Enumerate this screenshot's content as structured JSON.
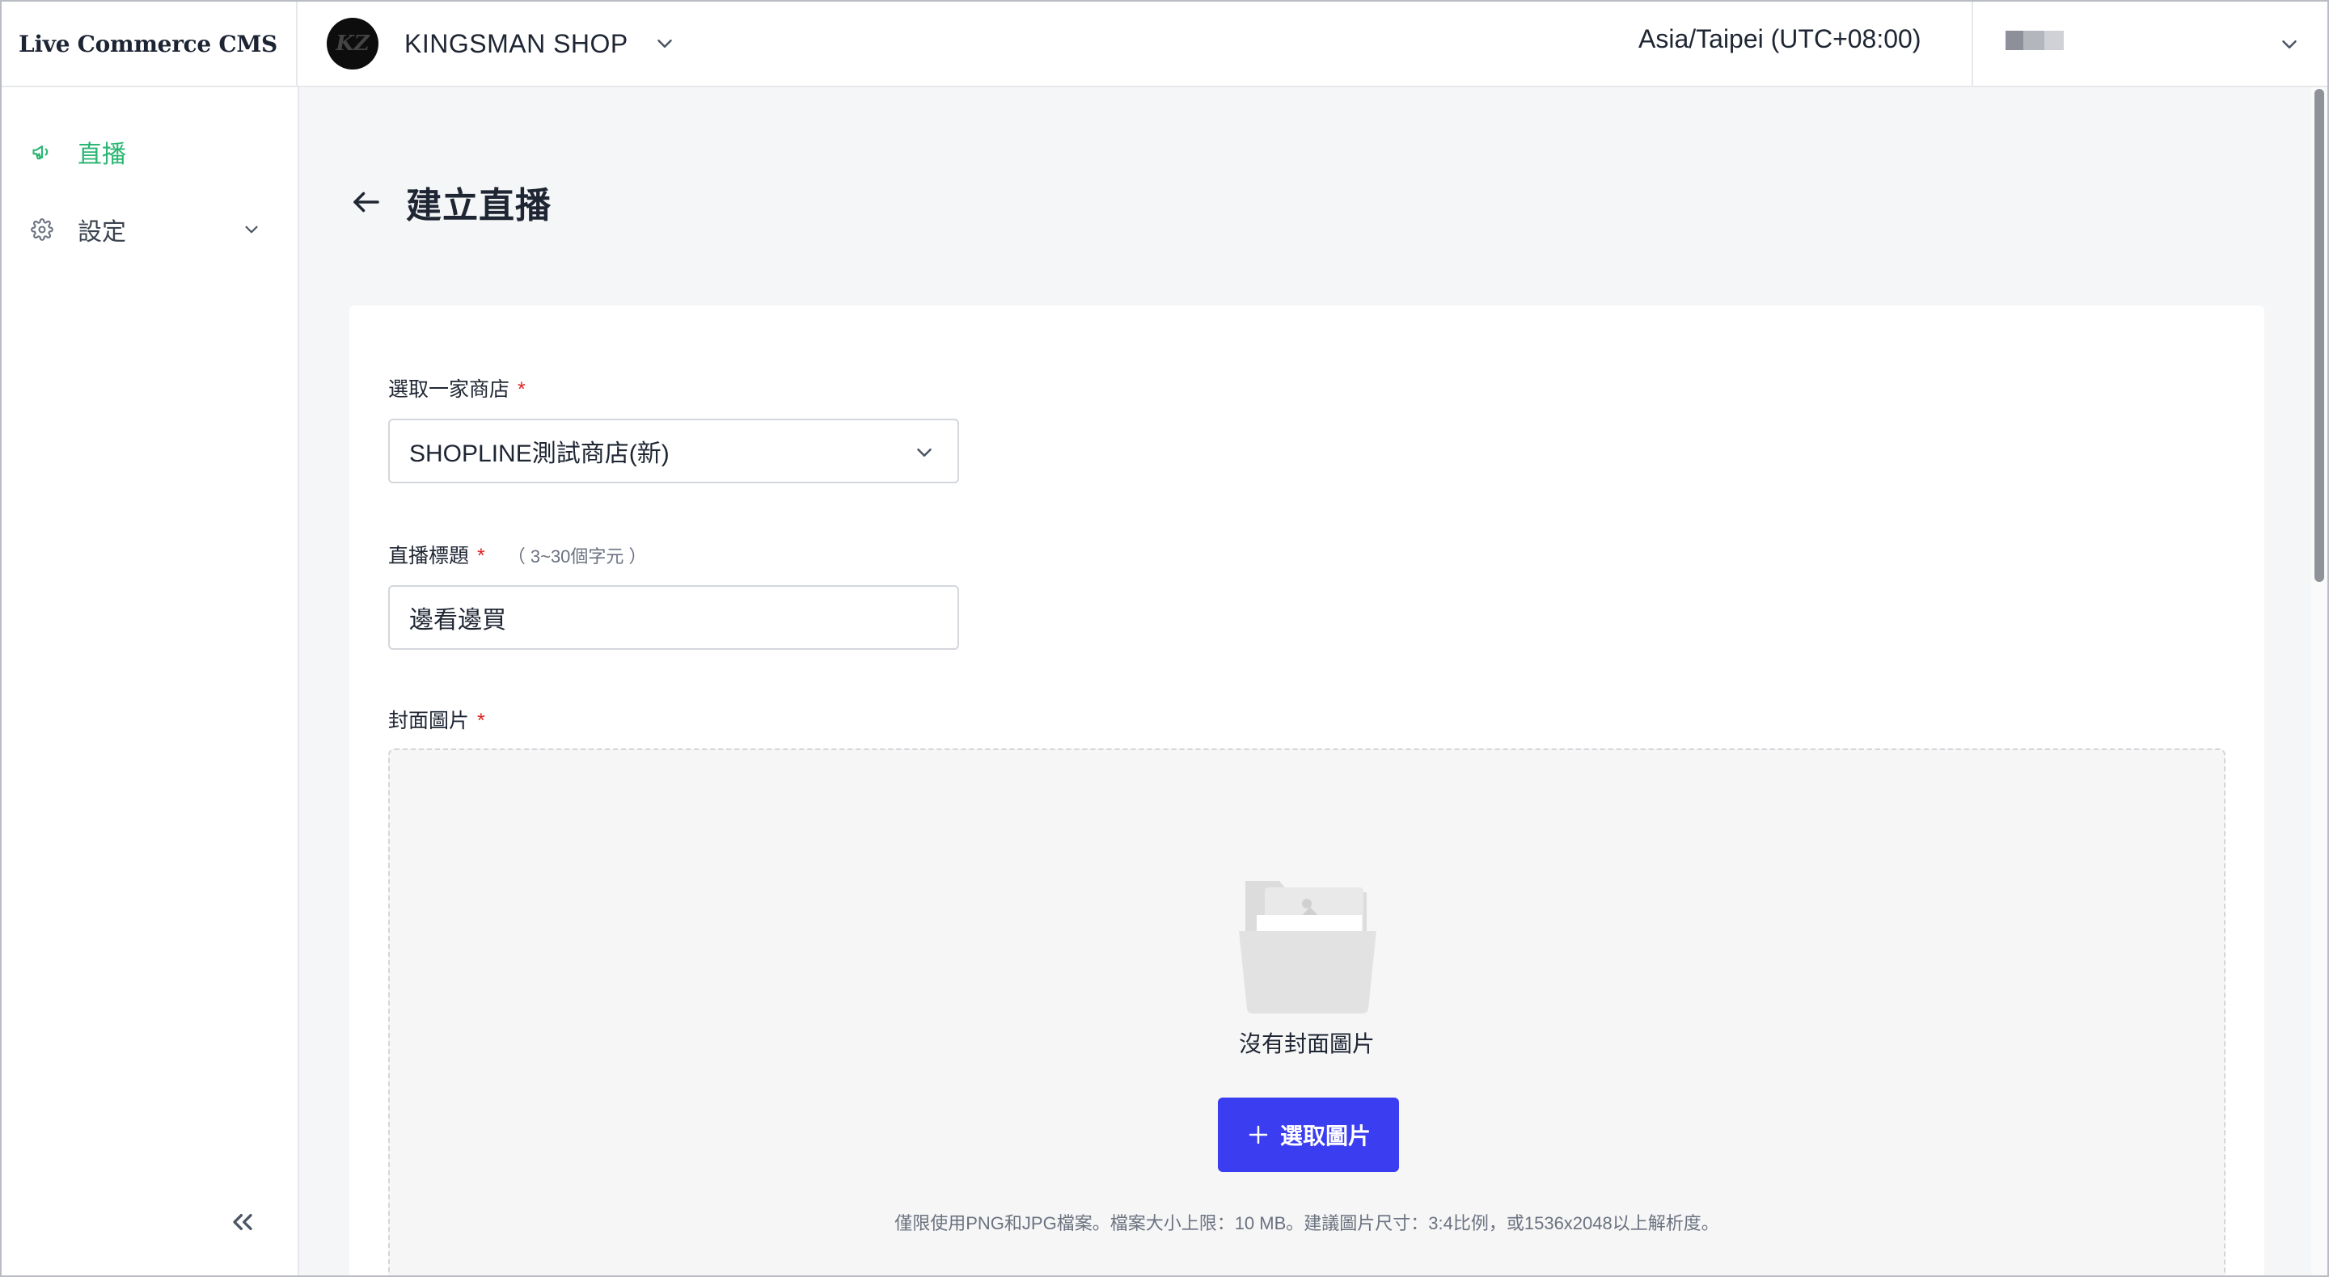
{
  "app": {
    "title": "Live Commerce CMS"
  },
  "header": {
    "shop_logo_text": "KZ",
    "shop_name": "KINGSMAN SHOP",
    "timezone": "Asia/Taipei (UTC+08:00)"
  },
  "sidebar": {
    "items": [
      {
        "label": "直播",
        "icon": "megaphone-icon",
        "active": true
      },
      {
        "label": "設定",
        "icon": "gear-icon",
        "active": false
      }
    ]
  },
  "page": {
    "title": "建立直播"
  },
  "form": {
    "store": {
      "label": "選取一家商店",
      "required_mark": "*",
      "value": "SHOPLINE測試商店(新)"
    },
    "live_title": {
      "label": "直播標題",
      "required_mark": "*",
      "hint": "（ 3~30個字元 ）",
      "value": "邊看邊買"
    },
    "cover": {
      "label": "封面圖片",
      "required_mark": "*",
      "empty_text": "沒有封面圖片",
      "button_label": "選取圖片",
      "note": "僅限使用PNG和JPG檔案。檔案大小上限：10 MB。建議圖片尺寸：3:4比例，或1536x2048以上解析度。"
    }
  },
  "colors": {
    "accent_green": "#2bb673",
    "primary_blue": "#3b3df0",
    "required_red": "#e02424"
  }
}
